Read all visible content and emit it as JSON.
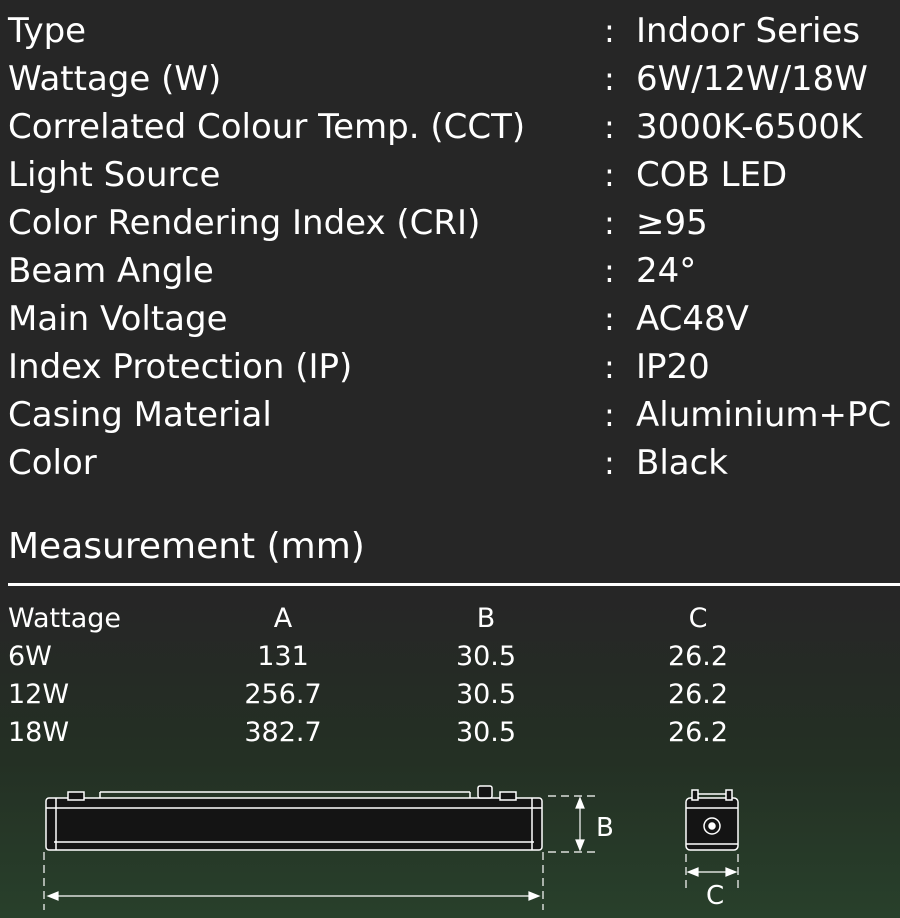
{
  "specs": [
    {
      "label": "Type",
      "value": "Indoor Series"
    },
    {
      "label": "Wattage (W)",
      "value": "6W/12W/18W"
    },
    {
      "label": "Correlated Colour Temp. (CCT)",
      "value": "3000K-6500K"
    },
    {
      "label": "Light Source",
      "value": "COB LED"
    },
    {
      "label": "Color Rendering Index (CRI)",
      "value": "≥95"
    },
    {
      "label": "Beam Angle",
      "value": "24°"
    },
    {
      "label": "Main Voltage",
      "value": "AC48V"
    },
    {
      "label": "Index Protection (IP)",
      "value": "IP20"
    },
    {
      "label": "Casing Material",
      "value": "Aluminium+PC"
    },
    {
      "label": "Color",
      "value": "Black"
    }
  ],
  "separator": ":",
  "measurement": {
    "title": "Measurement (mm)",
    "headers": [
      "Wattage",
      "A",
      "B",
      "C"
    ],
    "rows": [
      [
        "6W",
        "131",
        "30.5",
        "26.2"
      ],
      [
        "12W",
        "256.7",
        "30.5",
        "26.2"
      ],
      [
        "18W",
        "382.7",
        "30.5",
        "26.2"
      ]
    ]
  },
  "drawing": {
    "label_b": "B",
    "label_c": "C"
  }
}
